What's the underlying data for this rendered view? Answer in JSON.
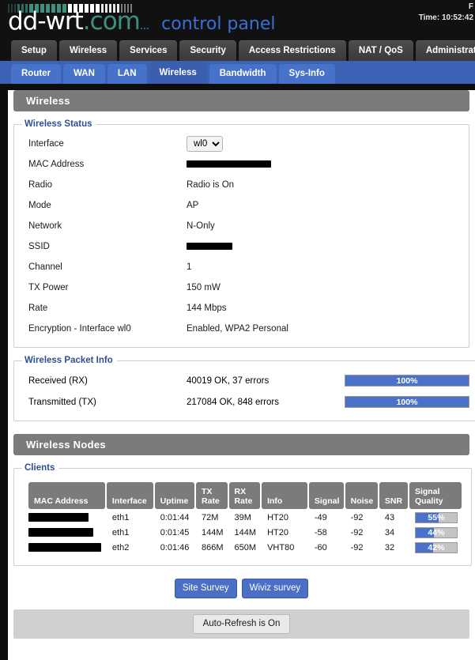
{
  "header": {
    "brand_dd": "dd-wrt",
    "brand_com": ".com",
    "control_panel_dots": "...",
    "control_panel": "control panel",
    "time_label": "Time: 10:52:42",
    "corner_text": "F"
  },
  "main_tabs": [
    {
      "label": "Setup",
      "active": false
    },
    {
      "label": "Wireless",
      "active": false
    },
    {
      "label": "Services",
      "active": false
    },
    {
      "label": "Security",
      "active": false
    },
    {
      "label": "Access Restrictions",
      "active": false
    },
    {
      "label": "NAT / QoS",
      "active": false
    },
    {
      "label": "Administration",
      "active": false
    }
  ],
  "sub_tabs": [
    {
      "label": "Router",
      "active": false
    },
    {
      "label": "WAN",
      "active": false
    },
    {
      "label": "LAN",
      "active": false
    },
    {
      "label": "Wireless",
      "active": true
    },
    {
      "label": "Bandwidth",
      "active": false
    },
    {
      "label": "Sys-Info",
      "active": false
    }
  ],
  "sections": {
    "wireless_title": "Wireless",
    "wireless_nodes_title": "Wireless Nodes"
  },
  "wireless_status": {
    "legend": "Wireless Status",
    "interface_label": "Interface",
    "interface_value": "wl0",
    "interface_options": [
      "wl0"
    ],
    "mac_label": "MAC Address",
    "mac_value": "",
    "radio_label": "Radio",
    "radio_value": "Radio is On",
    "mode_label": "Mode",
    "mode_value": "AP",
    "network_label": "Network",
    "network_value": "N-Only",
    "ssid_label": "SSID",
    "ssid_value": "",
    "channel_label": "Channel",
    "channel_value": "1",
    "txpower_label": "TX Power",
    "txpower_value": "150 mW",
    "rate_label": "Rate",
    "rate_value": "144 Mbps",
    "encryption_label": "Encryption - Interface wl0",
    "encryption_value": "Enabled, WPA2 Personal"
  },
  "packet_info": {
    "legend": "Wireless Packet Info",
    "rows": [
      {
        "label": "Received (RX)",
        "value": "40019 OK, 37 errors",
        "percent": 100,
        "percent_label": "100%"
      },
      {
        "label": "Transmitted (TX)",
        "value": "217084 OK, 848 errors",
        "percent": 100,
        "percent_label": "100%"
      }
    ]
  },
  "clients": {
    "legend": "Clients",
    "columns": [
      "MAC Address",
      "Interface",
      "Uptime",
      "TX Rate",
      "RX Rate",
      "Info",
      "Signal",
      "Noise",
      "SNR",
      "Signal Quality"
    ],
    "rows": [
      {
        "mac": "",
        "interface": "eth1",
        "uptime": "0:01:44",
        "tx_rate": "72M",
        "rx_rate": "39M",
        "info": "HT20",
        "signal": "-49",
        "noise": "-92",
        "snr": "43",
        "quality_percent": 55,
        "quality_label": "55%"
      },
      {
        "mac": "",
        "interface": "eth1",
        "uptime": "0:01:45",
        "tx_rate": "144M",
        "rx_rate": "144M",
        "info": "HT20",
        "signal": "-58",
        "noise": "-92",
        "snr": "34",
        "quality_percent": 44,
        "quality_label": "44%"
      },
      {
        "mac": "",
        "interface": "eth2",
        "uptime": "0:01:46",
        "tx_rate": "866M",
        "rx_rate": "650M",
        "info": "VHT80",
        "signal": "-60",
        "noise": "-92",
        "snr": "32",
        "quality_percent": 42,
        "quality_label": "42%"
      }
    ]
  },
  "buttons": {
    "site_survey": "Site Survey",
    "wiviz_survey": "Wiviz survey",
    "auto_refresh": "Auto-Refresh is On"
  },
  "colors": {
    "accent_blue": "#4a72c8",
    "subtab_blue": "#4672c9",
    "section_gray": "#7b7b7b",
    "legend_blue": "#2f4f93",
    "brand_teal": "#3f8f7f"
  }
}
